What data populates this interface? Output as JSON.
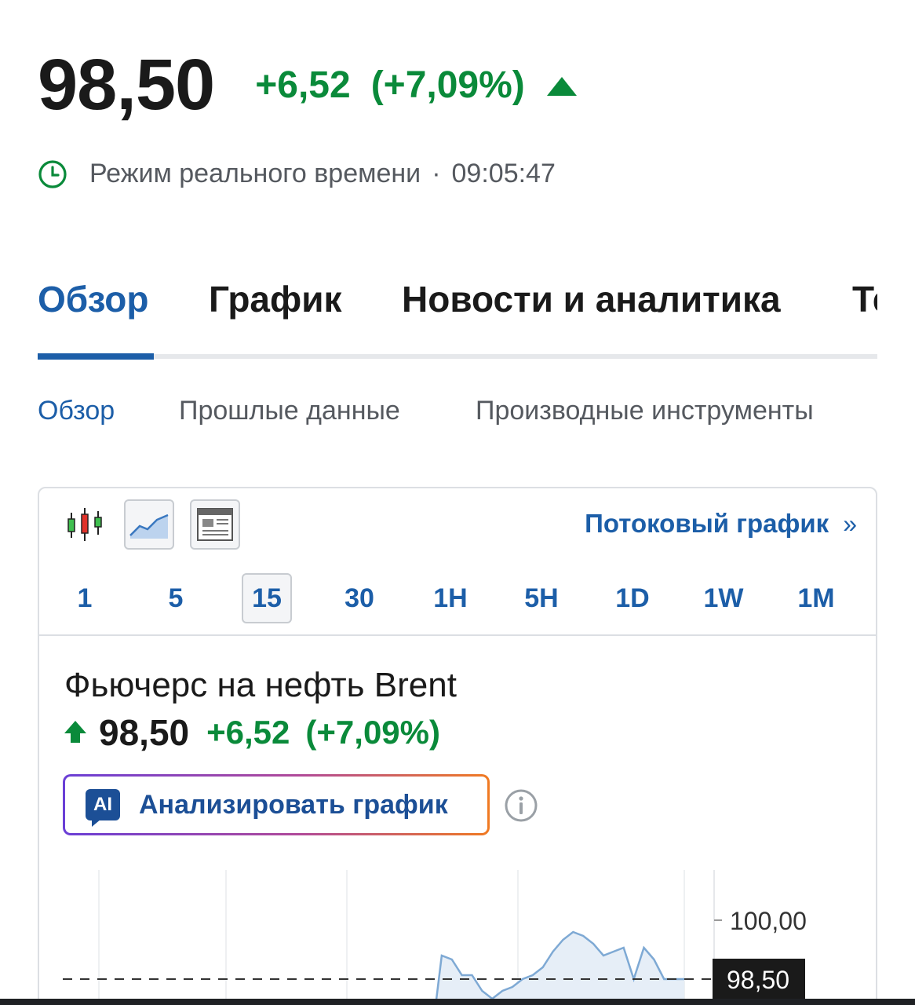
{
  "quote": {
    "price": "98,50",
    "change": "+6,52",
    "change_pct": "(+7,09%)",
    "direction": "up"
  },
  "realtime": {
    "label": "Режим реального времени",
    "separator": "·",
    "time": "09:05:47"
  },
  "main_tabs": [
    {
      "label": "Обзор",
      "active": true
    },
    {
      "label": "График",
      "active": false
    },
    {
      "label": "Новости и аналитика",
      "active": false
    },
    {
      "label": "Те",
      "active": false
    }
  ],
  "sub_tabs": [
    {
      "label": "Обзор",
      "active": true
    },
    {
      "label": "Прошлые данные",
      "active": false
    },
    {
      "label": "Производные инструменты",
      "active": false
    }
  ],
  "chart_panel": {
    "chart_types": [
      "candlestick-icon",
      "area-chart-icon",
      "table-view-icon"
    ],
    "stream_link": "Потоковый график",
    "stream_link_chevron": "»",
    "intervals": [
      {
        "label": "1",
        "active": false
      },
      {
        "label": "5",
        "active": false
      },
      {
        "label": "15",
        "active": true
      },
      {
        "label": "30",
        "active": false
      },
      {
        "label": "1H",
        "active": false
      },
      {
        "label": "5H",
        "active": false
      },
      {
        "label": "1D",
        "active": false
      },
      {
        "label": "1W",
        "active": false
      },
      {
        "label": "1M",
        "active": false
      }
    ],
    "instrument": {
      "name": "Фьючерс на нефть Brent",
      "price": "98,50",
      "change": "+6,52",
      "change_pct": "(+7,09%)"
    },
    "ai_button": {
      "badge": "AI",
      "label": "Анализировать график"
    }
  },
  "chart_data": {
    "type": "area",
    "y_tick_labels": [
      "100,00"
    ],
    "current_value_label": "98,50",
    "current_value": 98.5,
    "ylim": [
      97.6,
      101.4
    ],
    "x": [
      0,
      1,
      2,
      3,
      4,
      5,
      6,
      7,
      8,
      9,
      10,
      11,
      12,
      13,
      14,
      15,
      16,
      17,
      18,
      19,
      20,
      21,
      22,
      23,
      24,
      25
    ],
    "values": [
      94.0,
      99.1,
      99.0,
      98.6,
      98.6,
      98.2,
      98.0,
      98.2,
      98.3,
      98.5,
      98.6,
      98.8,
      99.2,
      99.5,
      99.7,
      99.6,
      99.4,
      99.1,
      99.2,
      99.3,
      98.5,
      99.3,
      99.0,
      98.5,
      98.5,
      98.5
    ],
    "colors": {
      "line": "#7ea9d4",
      "fill": "#e6eef7",
      "positive": "#0a8a3a",
      "accent": "#1c5ea8"
    },
    "grid": true
  }
}
